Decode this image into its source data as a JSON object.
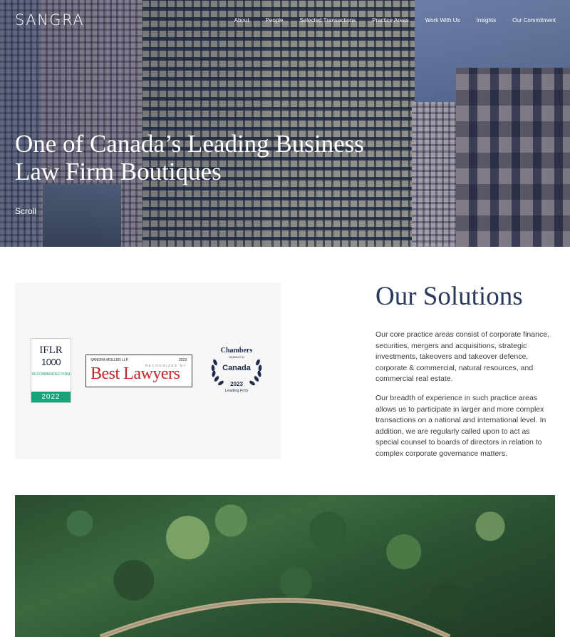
{
  "brand": {
    "logo_text": "SANGRA"
  },
  "nav": {
    "items": [
      "About",
      "People",
      "Selected Transactions",
      "Practice Areas",
      "Work With Us",
      "Insights",
      "Our Commitment"
    ]
  },
  "hero": {
    "title": "One of Canada’s Leading Business Law Firm Boutiques",
    "scroll_label": "Scroll"
  },
  "awards": {
    "iflr": {
      "title": "IFLR",
      "number": "1000",
      "recommended": "RECOMMENDED FIRM",
      "year": "2022"
    },
    "best_lawyers": {
      "firm": "SANGRA MOLLER LLP",
      "year": "2023",
      "recognized": "RECOGNIZED BY",
      "brand": "Best Lawyers"
    },
    "chambers": {
      "title": "Chambers",
      "ranked": "RANKED IN",
      "country": "Canada",
      "year": "2023",
      "tier": "Leading Firm"
    }
  },
  "solutions": {
    "title": "Our Solutions",
    "paragraph1": "Our core practice areas consist of corporate finance, securities, mergers and acquisitions, strategic investments, takeovers and takeover defence, corporate & commercial, natural resources, and commercial real estate.",
    "paragraph2": "Our breadth of experience in such practice areas allows us to participate in larger and more complex transactions on a national and international level. In addition, we are regularly called upon to act as special counsel to boards of directors in relation to complex corporate governance matters."
  },
  "colors": {
    "heading_navy": "#2a3a5e",
    "iflr_green": "#1aa179",
    "best_lawyers_red": "#c8222a",
    "chambers_navy": "#1d2c4a"
  }
}
